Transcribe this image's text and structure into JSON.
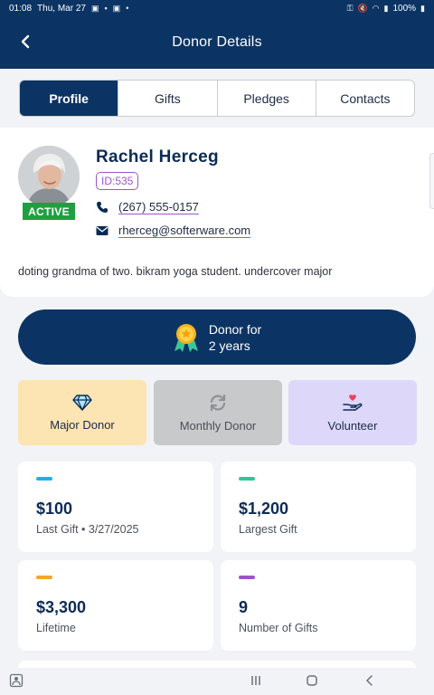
{
  "status_bar": {
    "time": "01:08",
    "date": "Thu, Mar 27",
    "battery": "100%"
  },
  "header": {
    "title": "Donor Details"
  },
  "tabs": [
    {
      "label": "Profile",
      "active": true
    },
    {
      "label": "Gifts",
      "active": false
    },
    {
      "label": "Pledges",
      "active": false
    },
    {
      "label": "Contacts",
      "active": false
    }
  ],
  "profile": {
    "status": "ACTIVE",
    "name": "Rachel Herceg",
    "id_label": "ID:535",
    "phone": "(267) 555-0157",
    "email": "rherceg@softerware.com",
    "bio": "doting grandma of two. bikram yoga student. undercover major"
  },
  "donor_for": {
    "line1": "Donor for",
    "line2": "2 years"
  },
  "donor_types": [
    {
      "label": "Major Donor",
      "icon": "diamond-icon"
    },
    {
      "label": "Monthly Donor",
      "icon": "refresh-icon"
    },
    {
      "label": "Volunteer",
      "icon": "heart-hand-icon"
    }
  ],
  "stats": [
    {
      "value": "$100",
      "label": "Last Gift • 3/27/2025",
      "color": "#1fb2ea"
    },
    {
      "value": "$1,200",
      "label": "Largest Gift",
      "color": "#34c49a"
    },
    {
      "value": "$3,300",
      "label": "Lifetime",
      "color": "#f0a82c"
    },
    {
      "value": "9",
      "label": "Number of Gifts",
      "color": "#a052c9"
    }
  ],
  "colors": {
    "primary": "#0b3464",
    "active_green": "#1fa040",
    "id_purple": "#9b57c7"
  }
}
